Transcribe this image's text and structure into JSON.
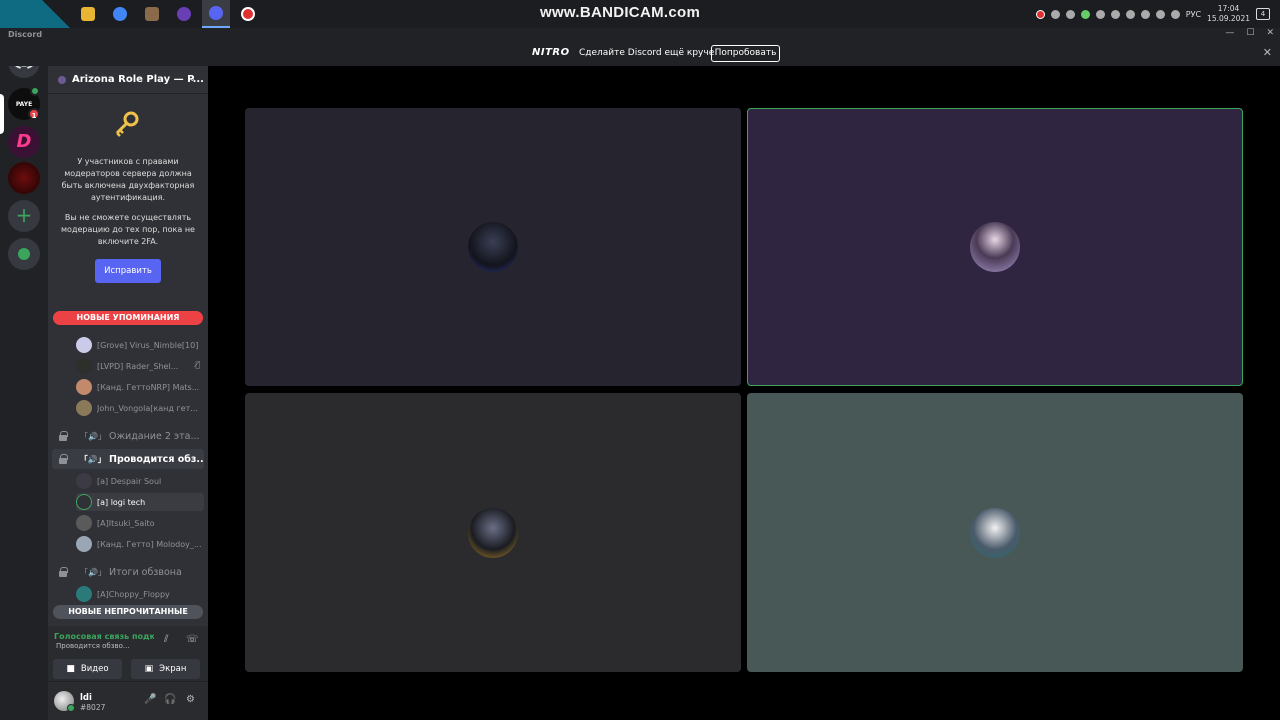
{
  "taskbar": {
    "watermark": "www.BANDICAM.com",
    "tray_lang": "РУС",
    "time": "17:04",
    "date": "15.09.2021",
    "notifications": "4"
  },
  "window": {
    "title": "Discord"
  },
  "nitro_banner": {
    "logo": "NITRO",
    "message": "Сделайте Discord ещё круче!",
    "button": "Попробовать"
  },
  "rail": {
    "paye_label": "PAYE",
    "paye_badge": "1",
    "d_label": "D",
    "add_label": "+"
  },
  "guild": {
    "name": "Arizona Role Play — P..."
  },
  "twofa": {
    "text1": "У участников с правами модераторов сервера должна быть включена двухфакторная аутентификация.",
    "text2": "Вы не сможете осуществлять модерацию до тех пор, пока не включите 2FA.",
    "button": "Исправить"
  },
  "banners": {
    "mentions": "НОВЫЕ УПОМИНАНИЯ",
    "unread": "НОВЫЕ НЕПРОЧИТАННЫЕ"
  },
  "channels": {
    "group1": [
      {
        "name": "[Grove] Virus_Nimble[10]"
      },
      {
        "name": "[LVPD] Rader_Shel..."
      },
      {
        "name": "[Канд. ГеттоNRP] Mats..."
      },
      {
        "name": "John_Vongola[канд гет..."
      }
    ],
    "wait2": "Ожидание 2 эта...",
    "current": "Проводится обз...",
    "group2": [
      {
        "name": "[a] Despair Soul"
      },
      {
        "name": "[a] logi tech"
      },
      {
        "name": "[A]Itsuki_Saito"
      },
      {
        "name": "[Канд. Гетто] Molodoy_..."
      }
    ],
    "results": "Итоги обзвона",
    "group3": [
      {
        "name": "[A]Choppy_Floppy"
      }
    ]
  },
  "voice_panel": {
    "status": "Голосовая связь подключена",
    "channel": "Проводится обзво...",
    "video": "Видео",
    "screen": "Экран"
  },
  "user": {
    "name": "ldi",
    "tag": "#8027"
  },
  "colors": {
    "accent": "#5865f2",
    "online": "#3ba55d",
    "danger": "#ed4245",
    "speaking_border": "#3ba55d"
  }
}
